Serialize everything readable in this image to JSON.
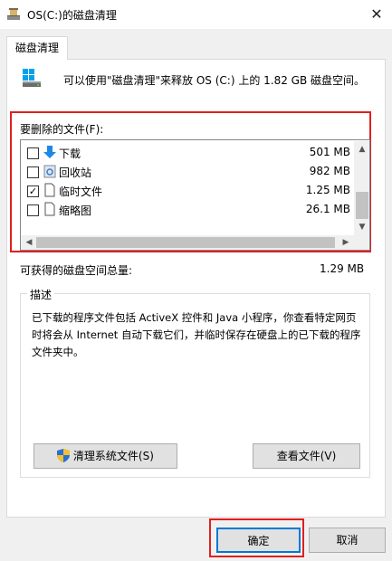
{
  "window": {
    "title": "OS(C:)的磁盘清理",
    "close_glyph": "✕"
  },
  "tab": {
    "label": "磁盘清理"
  },
  "summary": {
    "text": "可以使用\"磁盘清理\"来释放 OS (C:) 上的 1.82 GB 磁盘空间。"
  },
  "files": {
    "label": "要删除的文件(F):",
    "items": [
      {
        "name": "下载",
        "size": "501 MB",
        "checked": false,
        "icon": "download-arrow-icon"
      },
      {
        "name": "回收站",
        "size": "982 MB",
        "checked": false,
        "icon": "recycle-bin-icon"
      },
      {
        "name": "临时文件",
        "size": "1.25 MB",
        "checked": true,
        "icon": "file-icon"
      },
      {
        "name": "缩略图",
        "size": "26.1 MB",
        "checked": false,
        "icon": "file-icon"
      }
    ]
  },
  "space": {
    "label": "可获得的磁盘空间总量:",
    "value": "1.29 MB"
  },
  "description": {
    "title": "描述",
    "text": "已下载的程序文件包括 ActiveX 控件和 Java 小程序，你查看特定网页时将会从 Internet 自动下载它们，并临时保存在硬盘上的已下载的程序文件夹中。"
  },
  "buttons": {
    "clean_system": "清理系统文件(S)",
    "view_files": "查看文件(V)",
    "ok": "确定",
    "cancel": "取消"
  },
  "colors": {
    "highlight": "#e01f1f",
    "accent": "#0078d7"
  }
}
